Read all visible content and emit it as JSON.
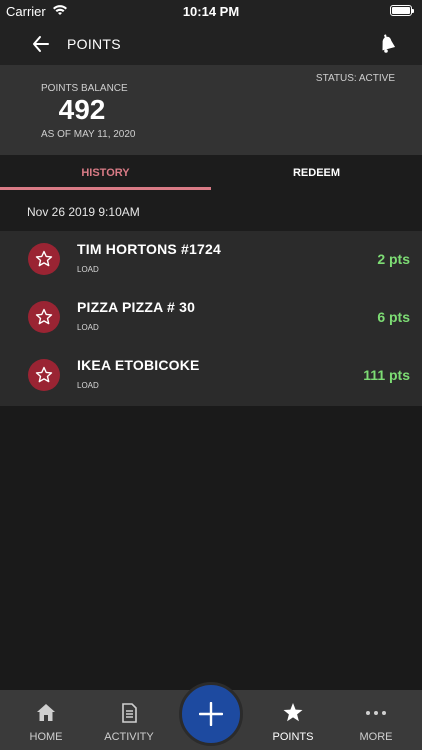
{
  "status_bar": {
    "carrier": "Carrier",
    "time": "10:14 PM"
  },
  "header": {
    "title": "POINTS",
    "back_icon": "back-arrow-icon",
    "bell_icon": "bell-icon"
  },
  "balance": {
    "label": "POINTS BALANCE",
    "value": "492",
    "as_of": "AS OF MAY 11, 2020",
    "status": "STATUS: ACTIVE"
  },
  "tabs": [
    {
      "label": "HISTORY",
      "active": true
    },
    {
      "label": "REDEEM",
      "active": false
    }
  ],
  "history": {
    "date": "Nov 26 2019  9:10AM",
    "items": [
      {
        "name": "TIM HORTONS #1724",
        "type": "LOAD",
        "points": "2 pts"
      },
      {
        "name": "PIZZA PIZZA # 30",
        "type": "LOAD",
        "points": "6 pts"
      },
      {
        "name": "IKEA ETOBICOKE",
        "type": "LOAD",
        "points": "111 pts"
      }
    ]
  },
  "bottom_nav": {
    "items": [
      {
        "label": "HOME",
        "icon": "home-icon"
      },
      {
        "label": "ACTIVITY",
        "icon": "document-icon"
      },
      {
        "label": "POINTS",
        "icon": "star-icon",
        "active": true
      },
      {
        "label": "MORE",
        "icon": "more-dots-icon"
      }
    ],
    "fab_icon": "plus-icon"
  },
  "colors": {
    "accent_pink": "#d97b86",
    "points_green": "#7ddc74",
    "badge_red": "#9a2433",
    "fab_blue": "#1d4aa0"
  }
}
